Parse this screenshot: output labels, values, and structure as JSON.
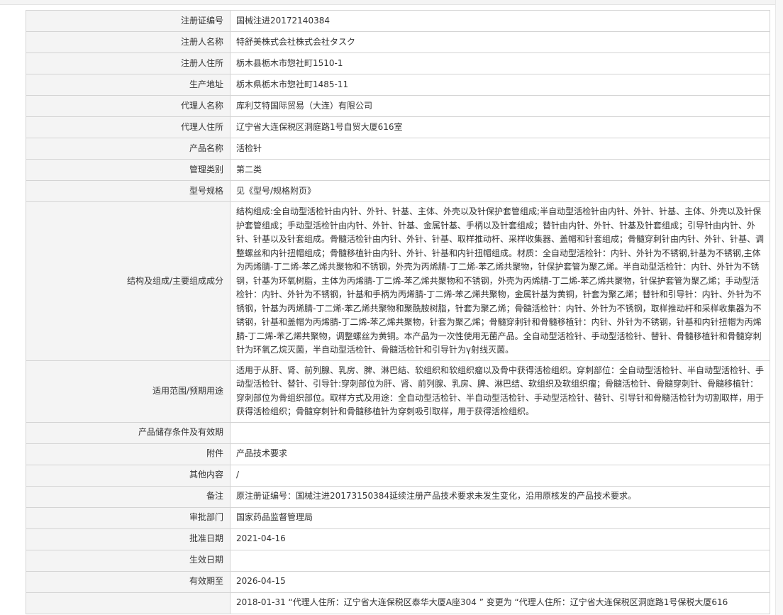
{
  "records": [
    {
      "label": "注册证编号",
      "value": "国械注进20172140384"
    },
    {
      "label": "注册人名称",
      "value": "特舒美株式会社株式会社タスク"
    },
    {
      "label": "注册人住所",
      "value": "栃木县栃木市惣社町1510-1"
    },
    {
      "label": "生产地址",
      "value": "栃木県栃木市惣社町1485-11"
    },
    {
      "label": "代理人名称",
      "value": "库利艾特国际贸易（大连）有限公司"
    },
    {
      "label": "代理人住所",
      "value": "辽宁省大连保税区洞庭路1号自贸大厦616室"
    },
    {
      "label": "产品名称",
      "value": "活检针"
    },
    {
      "label": "管理类别",
      "value": "第二类"
    },
    {
      "label": "型号规格",
      "value": "见《型号/规格附页》"
    },
    {
      "label": "结构及组成/主要组成成分",
      "value": "结构组成:全自动型活检针由内针、外针、针基、主体、外壳以及针保护套管组成;半自动型活检针由内针、外针、针基、主体、外壳以及针保护套管组成；手动型活检针由内针、外针、针基、金属针基、手柄以及针套组成；替针由内针、外针、针基及针套组成；引导针由内针、外针、针基以及针套组成。骨髓活检针由内针、外针、针基、取样推动杆、采样收集器、盖帽和针套组成；骨髓穿刺针由内针、外针、针基、调整螺丝和内针扭帽组成；骨髓移植针由内针、外针、针基和内针扭帽组成。材质：全自动型活检针：内针、外针为不锈钢,针基为不锈钢,主体为丙烯腈-丁二烯-苯乙烯共聚物和不锈钢，外壳为丙烯腈-丁二烯-苯乙烯共聚物，针保护套管为聚乙烯。半自动型活检针：内针、外针为不锈钢，针基为环氧树脂，主体为丙烯腈-丁二烯-苯乙烯共聚物和不锈钢，外壳为丙烯腈-丁二烯-苯乙烯共聚物，针保护套管为聚乙烯；手动型活检针：内针、外针为不锈钢，针基和手柄为丙烯腈-丁二烯-苯乙烯共聚物，金属针基为黄铜，针套为聚乙烯；替针和引导针：内针、外针为不锈钢，针基为丙烯腈-丁二烯-苯乙烯共聚物和聚酰胺树脂，针套为聚乙烯；骨髓活检针：内针、外针为不锈钢，取样推动杆和采样收集器为不锈钢，针基和盖帽为丙烯腈-丁二烯-苯乙烯共聚物，针套为聚乙烯；骨髓穿刺针和骨髓移植针：内针、外针为不锈钢，针基和内针扭帽为丙烯腈-丁二烯-苯乙烯共聚物，调整螺丝为黄铜。本产品为一次性使用无菌产品。全自动型活检针、手动型活检针、替针、骨髓移植针和骨髓穿刺针为环氧乙烷灭菌，半自动型活检针、骨髓活检针和引导针为γ射线灭菌。"
    },
    {
      "label": "适用范围/预期用途",
      "value": "适用于从肝、肾、前列腺、乳房、脾、淋巴结、软组织和软组织瘤以及骨中获得活检组织。穿刺部位：全自动型活检针、半自动型活检针、手动型活检针、替针、引导针:穿刺部位为肝、肾、前列腺、乳房、脾、淋巴结、软组织及软组织瘤；骨髓活检针、骨髓穿刺针、骨髓移植针：穿刺部位为骨组织部位。取样方式及用途：全自动型活检针、半自动型活检针、手动型活检针、替针、引导针和骨髓活检针为切割取样，用于获得活检组织；骨髓穿刺针和骨髓移植针为穿刺吸引取样，用于获得活检组织。"
    },
    {
      "label": "产品储存条件及有效期",
      "value": ""
    },
    {
      "label": "附件",
      "value": "产品技术要求"
    },
    {
      "label": "其他内容",
      "value": "/"
    },
    {
      "label": "备注",
      "value": "原注册证编号：国械注进20173150384延续注册产品技术要求未发生变化，沿用原核发的产品技术要求。"
    },
    {
      "label": "审批部门",
      "value": "国家药品监督管理局"
    },
    {
      "label": "批准日期",
      "value": "2021-04-16"
    },
    {
      "label": "生效日期",
      "value": ""
    },
    {
      "label": "有效期至",
      "value": "2026-04-15"
    },
    {
      "label": "",
      "value": "2018-01-31 “代理人住所：辽宁省大连保税区泰华大厦A座304 ” 变更为 “代理人住所：辽宁省大连保税区洞庭路1号保税大厦616"
    }
  ]
}
